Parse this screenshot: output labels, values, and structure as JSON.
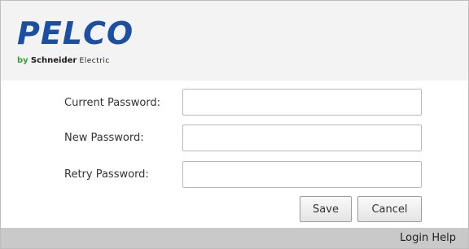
{
  "header": {
    "logo_text": "PELCO",
    "byline_prefix": "by",
    "byline_brand": "Schneider",
    "byline_suffix": "Electric",
    "logo_color": "#1b4fa1"
  },
  "form": {
    "current_password_label": "Current Password:",
    "new_password_label": "New Password:",
    "retry_password_label": "Retry Password:",
    "current_password_value": "",
    "new_password_value": "",
    "retry_password_value": ""
  },
  "buttons": {
    "save_label": "Save",
    "cancel_label": "Cancel"
  },
  "footer": {
    "login_help_label": "Login Help"
  }
}
